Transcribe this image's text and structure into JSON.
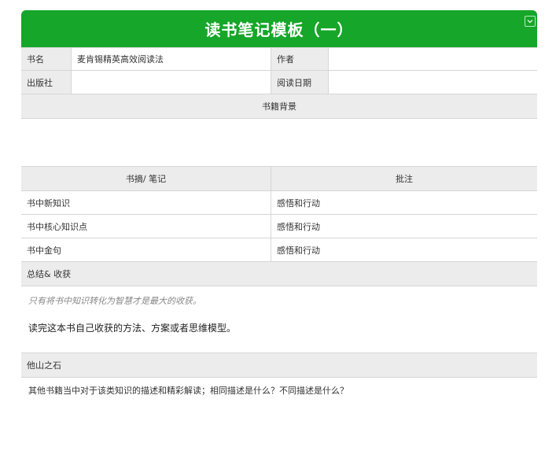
{
  "header": {
    "title": "读书笔记模板（一）"
  },
  "info": {
    "book_label": "书名",
    "book_value": "麦肯锡精英高效阅读法",
    "author_label": "作者",
    "author_value": "",
    "publisher_label": "出版社",
    "publisher_value": "",
    "date_label": "阅读日期",
    "date_value": ""
  },
  "background": {
    "label": "书籍背景",
    "content": ""
  },
  "notes": {
    "col_excerpt": "书摘/ 笔记",
    "col_comment": "批注",
    "rows": [
      {
        "label": "书中新知识",
        "comment": "感悟和行动"
      },
      {
        "label": "书中核心知识点",
        "comment": "感悟和行动"
      },
      {
        "label": "书中金句",
        "comment": "感悟和行动"
      }
    ]
  },
  "summary": {
    "label": "总结& 收获",
    "hint": "只有将书中知识转化为智慧才是最大的收获。",
    "content": "读完这本书自己收获的方法、方案或者思维模型。"
  },
  "others": {
    "label": "他山之石",
    "content": "其他书籍当中对于该类知识的描述和精彩解读；相同描述是什么？不同描述是什么？"
  },
  "colors": {
    "header": "#16a629",
    "label_bg": "#ececec",
    "border": "#d6d6d6"
  }
}
